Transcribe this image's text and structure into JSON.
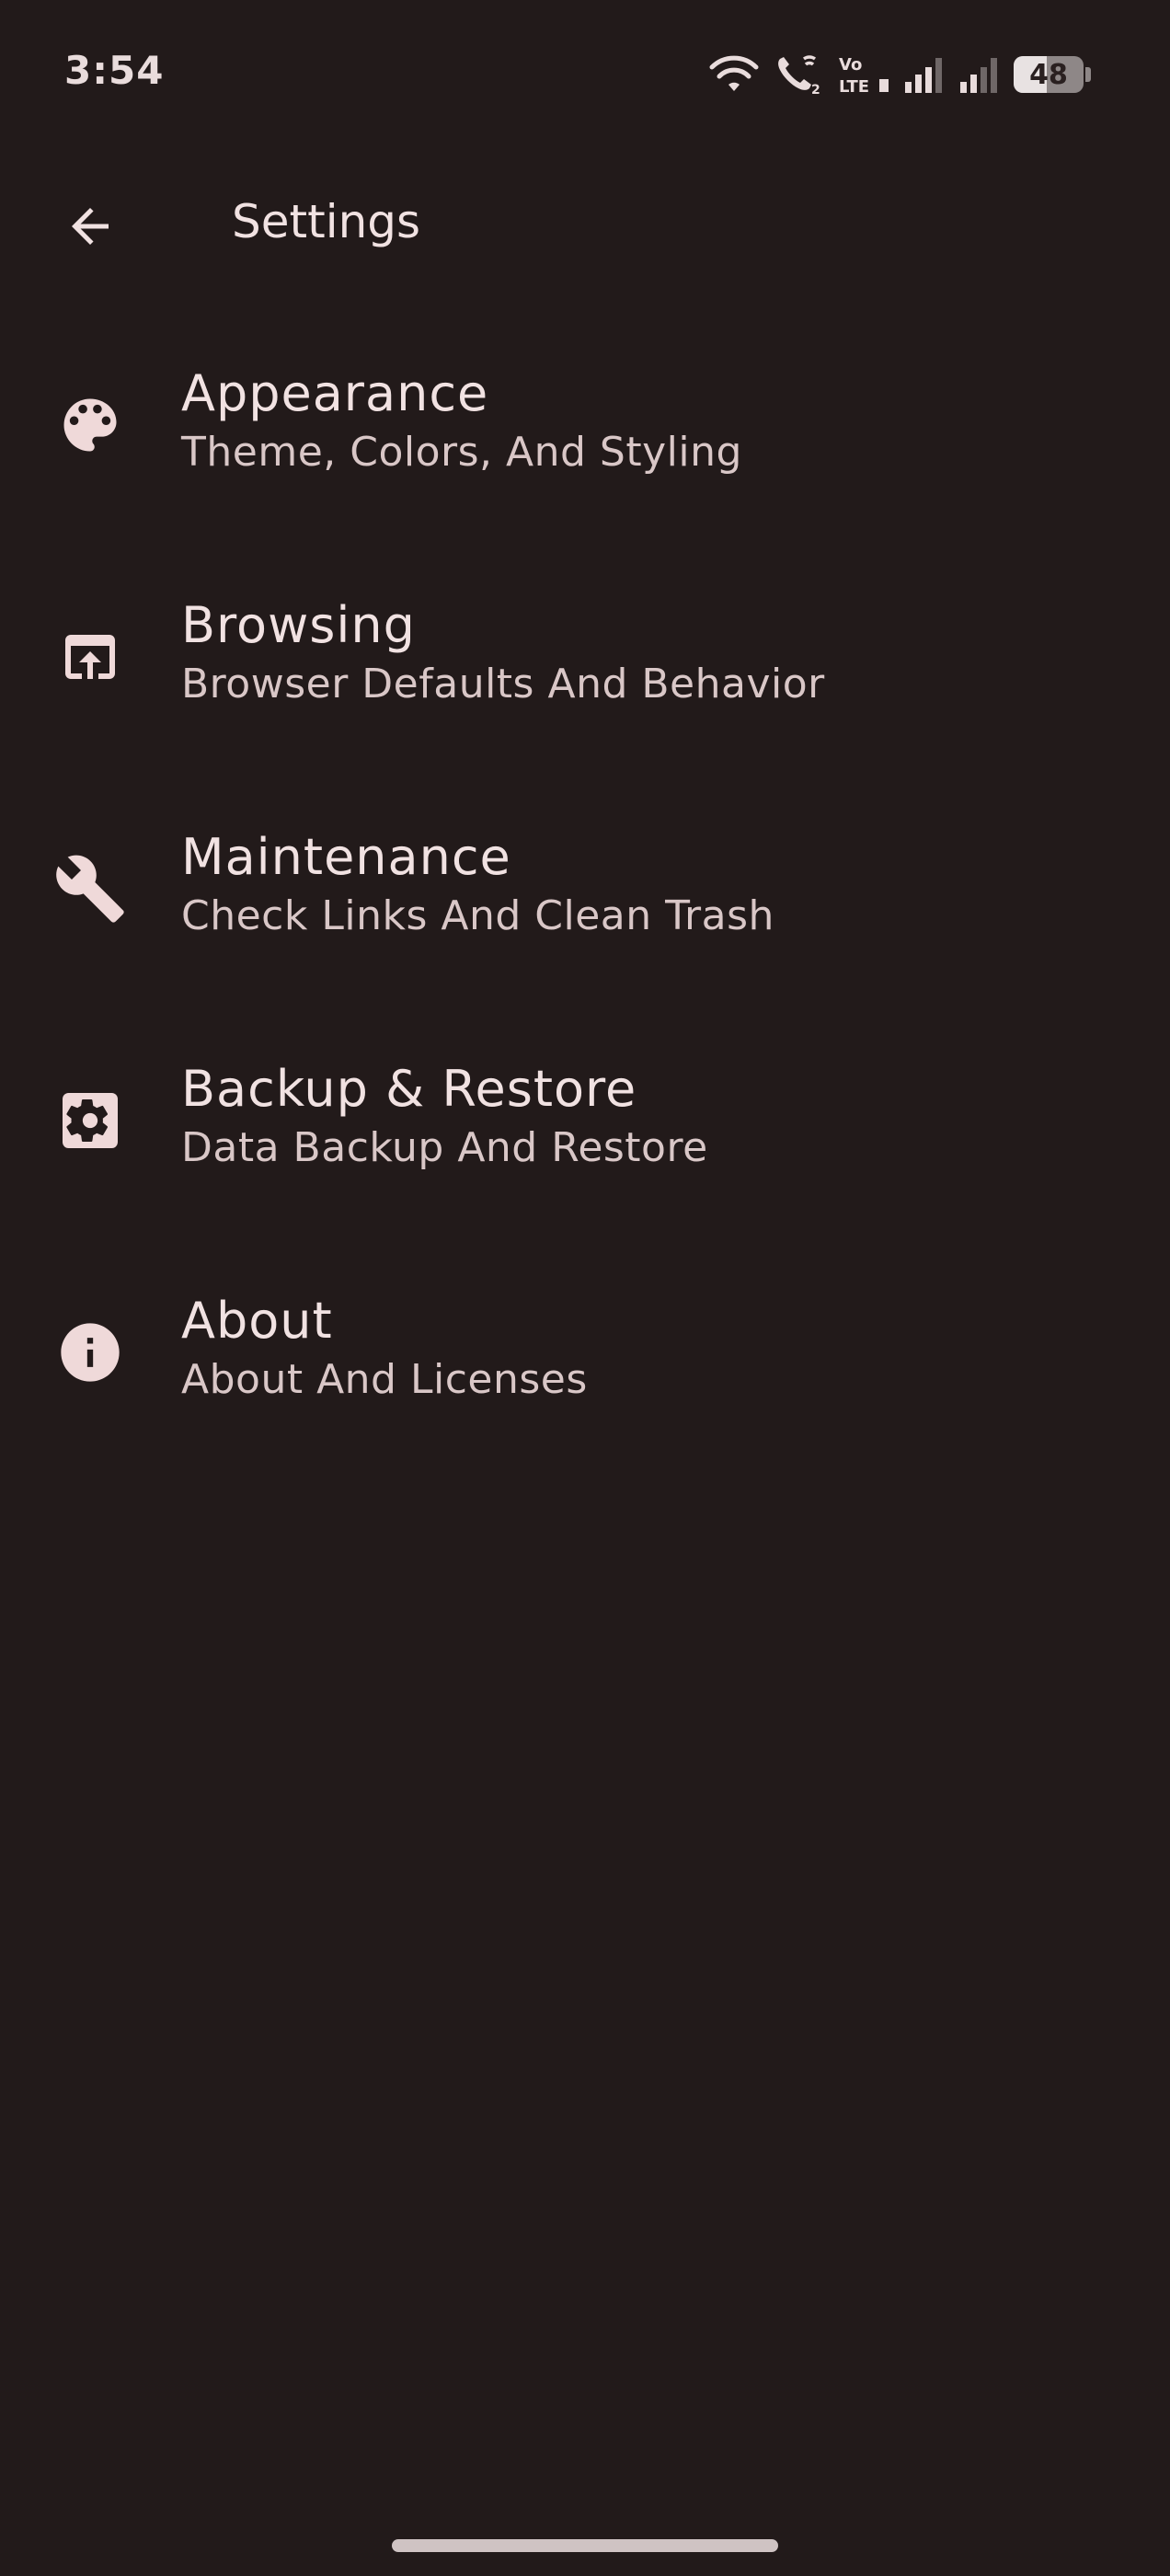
{
  "status_bar": {
    "time": "3:54",
    "battery_level": "48",
    "battery_fraction": 0.48,
    "network_label": "Vo LTE"
  },
  "app_bar": {
    "title": "Settings",
    "back_icon": "arrow-back-icon"
  },
  "settings": [
    {
      "icon": "palette-icon",
      "title": "Appearance",
      "subtitle": "Theme, Colors, And Styling"
    },
    {
      "icon": "open-in-browser-icon",
      "title": "Browsing",
      "subtitle": "Browser Defaults And Behavior"
    },
    {
      "icon": "wrench-icon",
      "title": "Maintenance",
      "subtitle": "Check Links And Clean Trash"
    },
    {
      "icon": "settings-backup-icon",
      "title": "Backup & Restore",
      "subtitle": "Data Backup And Restore"
    },
    {
      "icon": "info-icon",
      "title": "About",
      "subtitle": "About And Licenses"
    }
  ],
  "colors": {
    "background": "#221a1a",
    "text_primary": "#f1e2e2",
    "text_secondary": "#d9c7c7",
    "icon": "#efd9d9"
  }
}
